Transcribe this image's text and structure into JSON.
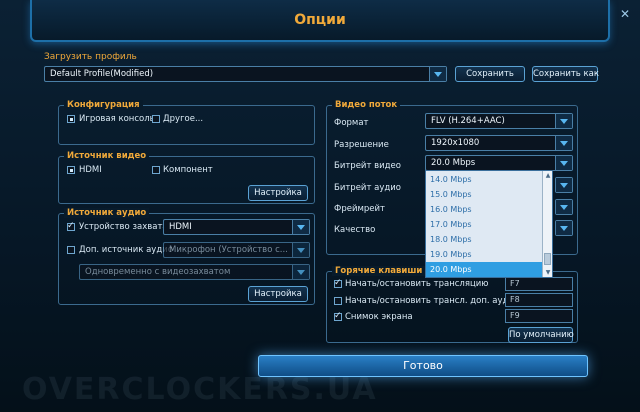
{
  "window": {
    "title": "Опции",
    "close_symbol": "✕"
  },
  "profile": {
    "label": "Загрузить профиль",
    "value": "Default Profile(Modified)",
    "save_label": "Сохранить",
    "save_as_label": "Сохранить как"
  },
  "config": {
    "title": "Конфигурация",
    "options": [
      "Игровая консоль",
      "Другое..."
    ]
  },
  "video_source": {
    "title": "Источник видео",
    "options": [
      "HDMI",
      "Компонент"
    ],
    "settings_label": "Настройка"
  },
  "audio_source": {
    "title": "Источник аудио",
    "capture_label": "Устройство захвата",
    "capture_value": "HDMI",
    "extra_label": "Доп. источник аудио",
    "extra_value": "Микрофон (Устройство с...",
    "mode_value": "Одновременно с видеозахватом",
    "settings_label": "Настройка"
  },
  "video_stream": {
    "title": "Видео поток",
    "format_label": "Формат",
    "format_value": "FLV (H.264+AAC)",
    "resolution_label": "Разрешение",
    "resolution_value": "1920x1080",
    "bitrate_label": "Битрейт видео",
    "bitrate_value": "20.0 Mbps",
    "audio_bitrate_label": "Битрейт аудио",
    "framerate_label": "Фреймрейт",
    "quality_label": "Качество",
    "bitrate_options": [
      "14.0 Mbps",
      "15.0 Mbps",
      "16.0 Mbps",
      "17.0 Mbps",
      "18.0 Mbps",
      "19.0 Mbps",
      "20.0 Mbps"
    ],
    "bitrate_selected": "20.0 Mbps"
  },
  "hotkeys": {
    "title": "Горячие клавиши",
    "items": [
      {
        "label": "Начать/остановить трансляцию",
        "key": "F7"
      },
      {
        "label": "Начать/остановить трансл. доп. аудио",
        "key": "F8"
      },
      {
        "label": "Снимок экрана",
        "key": "F9"
      }
    ],
    "default_label": "По умолчанию"
  },
  "footer": {
    "done_label": "Готово",
    "watermark": "OVERCLOCKERS.UA"
  },
  "colors": {
    "accent_orange": "#f0a93a",
    "accent_blue": "#2f9ee2",
    "background": "#061726"
  }
}
